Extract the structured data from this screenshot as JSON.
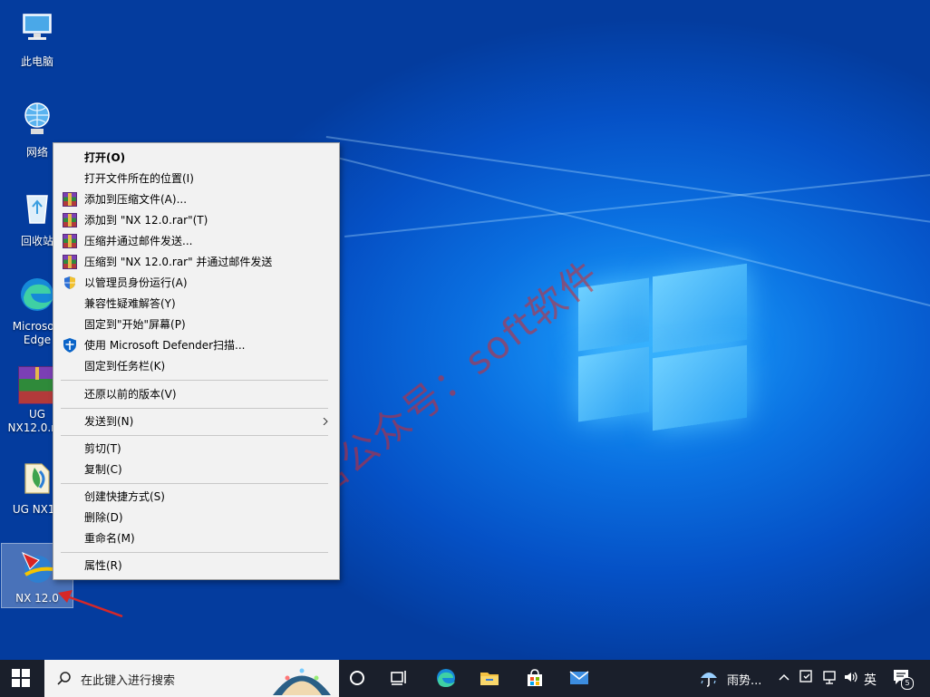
{
  "desktop": {
    "icons": [
      {
        "label": "此电脑",
        "icon": "computer-icon"
      },
      {
        "label": "网络",
        "icon": "network-icon"
      },
      {
        "label": "回收站",
        "icon": "recycle-bin-icon"
      },
      {
        "label": "Microsoft Edge",
        "icon": "edge-icon"
      },
      {
        "label": "UG NX12.0.rar",
        "icon": "winrar-archive-icon"
      },
      {
        "label": "UG NX12",
        "icon": "folder-zip-icon"
      },
      {
        "label": "NX 12.0",
        "icon": "nx-app-icon"
      }
    ]
  },
  "context_menu": {
    "items": [
      {
        "label": "打开(O)",
        "bold": true,
        "icon": ""
      },
      {
        "label": "打开文件所在的位置(I)",
        "icon": ""
      },
      {
        "label": "添加到压缩文件(A)...",
        "icon": "winrar-icon"
      },
      {
        "label": "添加到 \"NX 12.0.rar\"(T)",
        "icon": "winrar-icon"
      },
      {
        "label": "压缩并通过邮件发送...",
        "icon": "winrar-icon"
      },
      {
        "label": "压缩到 \"NX 12.0.rar\" 并通过邮件发送",
        "icon": "winrar-icon"
      },
      {
        "label": "以管理员身份运行(A)",
        "icon": "uac-shield-icon"
      },
      {
        "label": "兼容性疑难解答(Y)",
        "icon": ""
      },
      {
        "label": "固定到\"开始\"屏幕(P)",
        "icon": ""
      },
      {
        "label": "使用 Microsoft Defender扫描...",
        "icon": "defender-icon"
      },
      {
        "label": "固定到任务栏(K)",
        "icon": ""
      },
      {
        "label": "还原以前的版本(V)",
        "icon": ""
      },
      {
        "label": "发送到(N)",
        "icon": "",
        "submenu": true
      },
      {
        "label": "剪切(T)",
        "icon": ""
      },
      {
        "label": "复制(C)",
        "icon": ""
      },
      {
        "label": "创建快捷方式(S)",
        "icon": ""
      },
      {
        "label": "删除(D)",
        "icon": ""
      },
      {
        "label": "重命名(M)",
        "icon": ""
      },
      {
        "label": "属性(R)",
        "icon": ""
      }
    ]
  },
  "watermark": "微信公众号：soft软件",
  "taskbar": {
    "search_placeholder": "在此键入进行搜索",
    "weather": "雨势...",
    "ime": "英",
    "notification_count": "5"
  },
  "colors": {
    "accent": "#0a6fe0",
    "taskbar": "#1a1f2b",
    "annotation": "#d62828"
  }
}
